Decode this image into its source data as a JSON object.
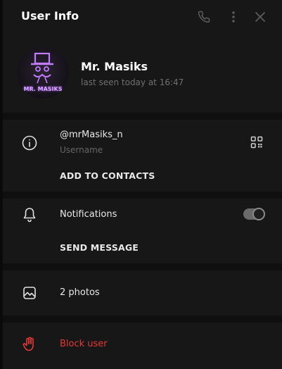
{
  "header": {
    "title": "User Info",
    "icons": [
      "phone-icon",
      "more-vertical-icon",
      "close-icon"
    ]
  },
  "profile": {
    "name": "Mr. Masiks",
    "status": "last seen today at 16:47",
    "avatar_text": "MR. MASIKS"
  },
  "info": {
    "username": "@mrMasiks_n",
    "username_caption": "Username",
    "add_to_contacts": "ADD TO CONTACTS"
  },
  "notifications": {
    "label": "Notifications",
    "enabled": true,
    "send_message": "SEND MESSAGE"
  },
  "media": {
    "photos_label": "2 photos"
  },
  "danger": {
    "block_label": "Block user",
    "color": "#e53935"
  },
  "colors": {
    "background": "#171717",
    "divider": "#0f0f0f",
    "secondary_text": "#6f6f6f",
    "avatar_accent": "#b15cff"
  }
}
